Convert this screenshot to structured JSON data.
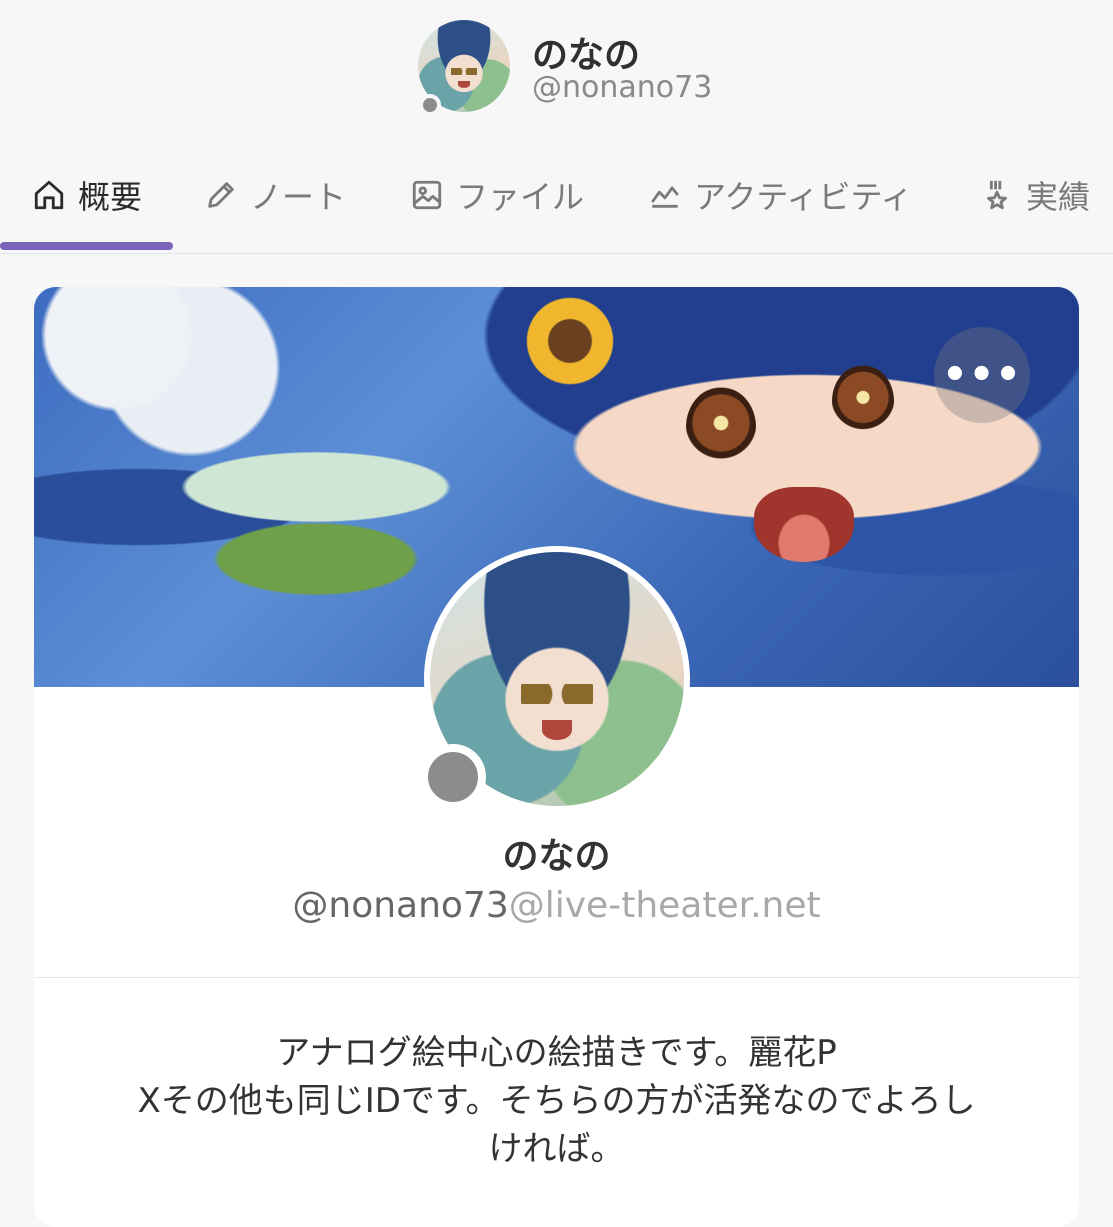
{
  "header": {
    "name": "のなの",
    "handle": "@nonano73"
  },
  "tabs": [
    {
      "label": "概要",
      "icon": "home-icon",
      "active": true
    },
    {
      "label": "ノート",
      "icon": "pencil-icon",
      "active": false
    },
    {
      "label": "ファイル",
      "icon": "image-icon",
      "active": false
    },
    {
      "label": "アクティビティ",
      "icon": "chart-line-icon",
      "active": false
    },
    {
      "label": "実績",
      "icon": "medal-icon",
      "active": false
    }
  ],
  "profile": {
    "name": "のなの",
    "handle_user": "@nonano73",
    "handle_host": "@live-theater.net",
    "more_label": "•••",
    "bio_lines": [
      "アナログ絵中心の絵描きです。麗花P",
      "Xその他も同じIDです。そちらの方が活発なのでよろし",
      "ければ。"
    ]
  },
  "colors": {
    "accent": "#7a63b8",
    "status_offline": "#8c8c8c",
    "background": "#f7f7f8",
    "card": "#ffffff"
  }
}
